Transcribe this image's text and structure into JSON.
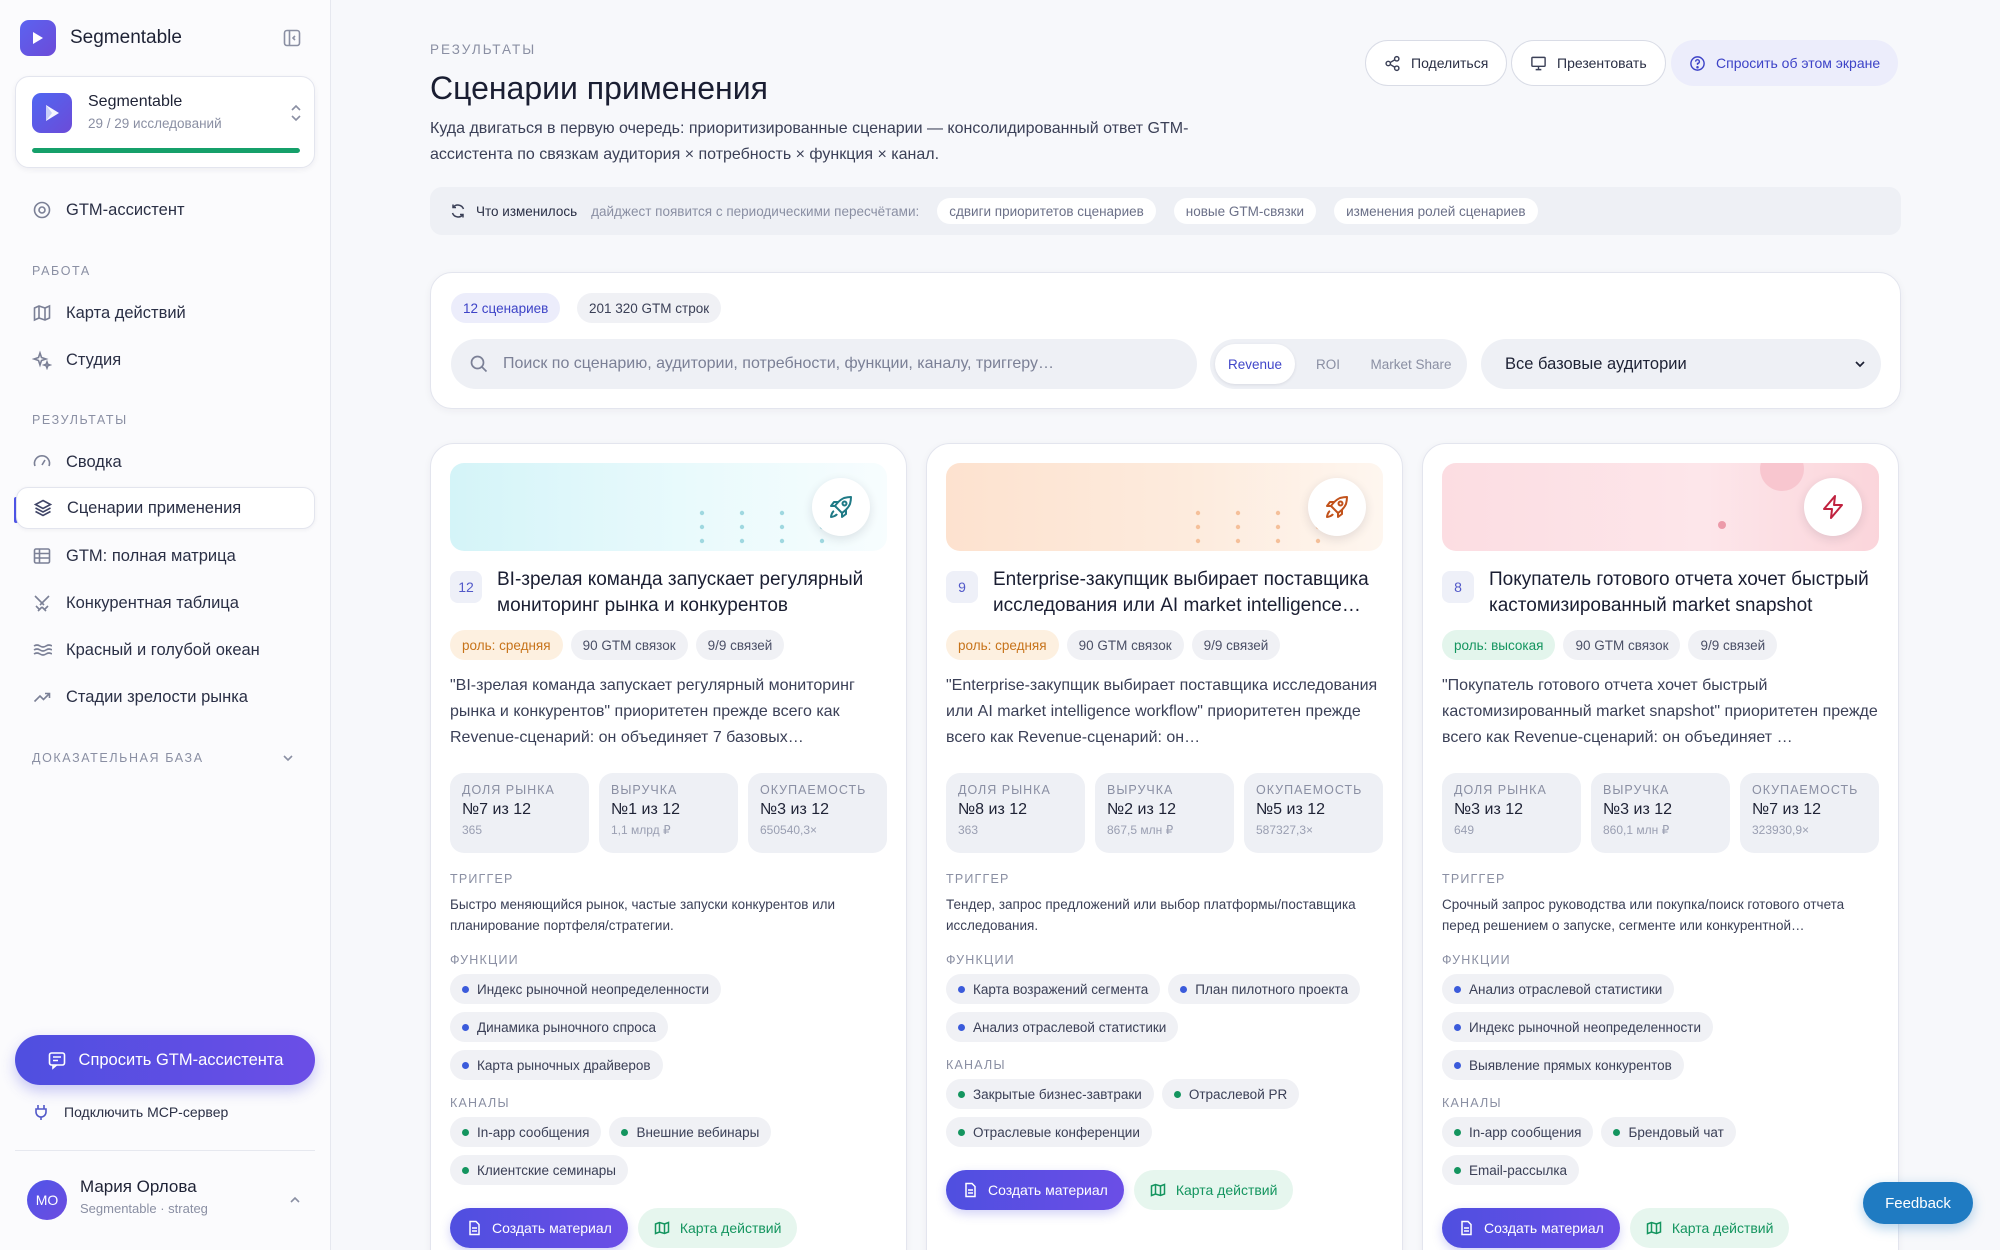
{
  "app": {
    "brand_name": "Segmentable"
  },
  "sidebar": {
    "workspace": {
      "title": "Segmentable",
      "subtitle": "29 / 29 исследований",
      "progress": 1.0
    },
    "assistant_item": {
      "label": "GTM-ассистент"
    },
    "section_work": "РАБОТА",
    "work_items": [
      {
        "label": "Карта действий"
      },
      {
        "label": "Студия"
      }
    ],
    "section_results": "РЕЗУЛЬТАТЫ",
    "result_items": [
      {
        "label": "Сводка"
      },
      {
        "label": "Сценарии применения"
      },
      {
        "label": "GTM: полная матрица"
      },
      {
        "label": "Конкурентная таблица"
      },
      {
        "label": "Красный и голубой океан"
      },
      {
        "label": "Стадии зрелости рынка"
      }
    ],
    "section_evidence": "ДОКАЗАТЕЛЬНАЯ БАЗА",
    "ask_button": "Спросить GTM-ассистента",
    "mcp_link": "Подключить MCP-сервер",
    "user": {
      "initials": "МО",
      "name": "Мария Орлова",
      "subtitle": "Segmentable · strateg"
    }
  },
  "header": {
    "eyebrow": "РЕЗУЛЬТАТЫ",
    "title": "Сценарии применения",
    "description": "Куда двигаться в первую очередь: приоритизированные сценарии — консолидированный ответ GTM-ассистента по связкам аудитория × потребность × функция × канал.",
    "share": "Поделиться",
    "present": "Презентовать",
    "ask_screen": "Спросить об этом экране"
  },
  "changes": {
    "title": "Что изменилось",
    "hint": "дайджест появится с периодическими пересчётами:",
    "chips": [
      "сдвиги приоритетов сценариев",
      "новые GTM-связки",
      "изменения ролей сценариев"
    ]
  },
  "filters": {
    "scenarios_count": "12 сценариев",
    "rows_count": "201 320 GTM строк",
    "search_placeholder": "Поиск по сценарию, аудитории, потребности, функции, каналу, триггеру…",
    "segments": [
      "Revenue",
      "ROI",
      "Market Share"
    ],
    "active_segment": "Revenue",
    "audience_select": "Все базовые аудитории"
  },
  "labels": {
    "trigger": "ТРИГГЕР",
    "functions": "ФУНКЦИИ",
    "channels": "КАНАЛЫ",
    "create_material": "Создать материал",
    "action_map": "Карта действий"
  },
  "cards": [
    {
      "rank": "12",
      "title": "BI-зрелая команда запускает регулярный мониторинг рынка и конкурентов",
      "role": "роль: средняя",
      "gtm_links": "90 GTM связок",
      "connections": "9/9 связей",
      "quote": "\"BI-зрелая команда запускает регулярный мониторинг рынка и конкурентов\" приоритетен прежде всего как Revenue-сценарий: он объединяет 7 базовых…",
      "metrics": [
        {
          "label": "ДОЛЯ РЫНКА",
          "value": "№7 из 12",
          "sub": "365"
        },
        {
          "label": "ВЫРУЧКА",
          "value": "№1 из 12",
          "sub": "1,1 млрд ₽"
        },
        {
          "label": "ОКУПАЕМОСТЬ",
          "value": "№3 из 12",
          "sub": "650540,3×"
        }
      ],
      "trigger": "Быстро меняющийся рынок, частые запуски конкурентов или планирование портфеля/стратегии.",
      "functions": [
        "Индекс рыночной неопределенности",
        "Динамика рыночного спроса",
        "Карта рыночных драйверов"
      ],
      "channels": [
        "In-app сообщения",
        "Внешние вебинары",
        "Клиентские семинары"
      ],
      "icon": "rocket-icon",
      "accent": "#1f7a86"
    },
    {
      "rank": "9",
      "title": "Enterprise-закупщик выбирает поставщика исследования или AI market intelligence workflow",
      "role": "роль: средняя",
      "gtm_links": "90 GTM связок",
      "connections": "9/9 связей",
      "quote": "\"Enterprise-закупщик выбирает поставщика исследования или AI market intelligence workflow\" приоритетен прежде всего как Revenue-сценарий: он…",
      "metrics": [
        {
          "label": "ДОЛЯ РЫНКА",
          "value": "№8 из 12",
          "sub": "363"
        },
        {
          "label": "ВЫРУЧКА",
          "value": "№2 из 12",
          "sub": "867,5 млн ₽"
        },
        {
          "label": "ОКУПАЕМОСТЬ",
          "value": "№5 из 12",
          "sub": "587327,3×"
        }
      ],
      "trigger": "Тендер, запрос предложений или выбор платформы/поставщика исследования.",
      "functions": [
        "Карта возражений сегмента",
        "План пилотного проекта",
        "Анализ отраслевой статистики"
      ],
      "channels": [
        "Закрытые бизнес-завтраки",
        "Отраслевой PR",
        "Отраслевые конференции"
      ],
      "icon": "rocket-icon",
      "accent": "#c2521b"
    },
    {
      "rank": "8",
      "title": "Покупатель готового отчета хочет быстрый кастомизированный market snapshot",
      "role": "роль: высокая",
      "gtm_links": "90 GTM связок",
      "connections": "9/9 связей",
      "quote": "\"Покупатель готового отчета хочет быстрый кастомизированный market snapshot\" приоритетен прежде всего как Revenue-сценарий: он объединяет …",
      "metrics": [
        {
          "label": "ДОЛЯ РЫНКА",
          "value": "№3 из 12",
          "sub": "649"
        },
        {
          "label": "ВЫРУЧКА",
          "value": "№3 из 12",
          "sub": "860,1 млн ₽"
        },
        {
          "label": "ОКУПАЕМОСТЬ",
          "value": "№7 из 12",
          "sub": "323930,9×"
        }
      ],
      "trigger": "Срочный запрос руководства или покупка/поиск готового отчета перед решением о запуске, сегменте или конкурентной…",
      "functions": [
        "Анализ отраслевой статистики",
        "Индекс рыночной неопределенности",
        "Выявление прямых конкурентов"
      ],
      "channels": [
        "In-app сообщения",
        "Брендовый чат",
        "Email-рассылка"
      ],
      "icon": "zap-icon",
      "accent": "#c0223f"
    }
  ],
  "feedback": "Feedback"
}
